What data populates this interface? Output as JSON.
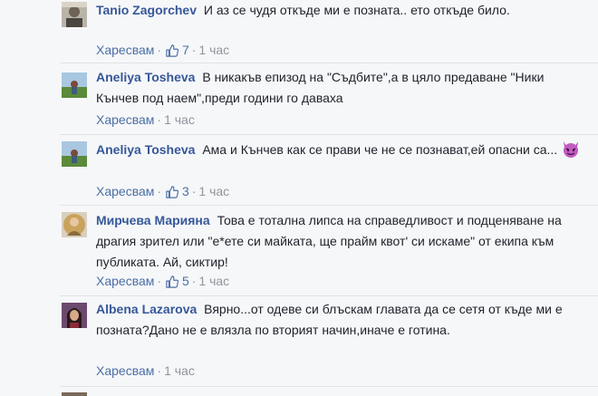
{
  "comments": [
    {
      "author": "Tanio Zagorchev",
      "text": "И аз се чудя откъде ми е позната.. ето откъде било.",
      "like_label": "Харесвам",
      "likes": "7",
      "time": "1 час"
    },
    {
      "author": "Aneliya Tosheva",
      "text": "В никакъв епизод на \"Съдбите\",а в цяло предаване \"Ники Кънчев под наем\",преди години го даваха",
      "like_label": "Харесвам",
      "likes": "",
      "time": "1 час"
    },
    {
      "author": "Aneliya Tosheva",
      "text": "Ама и Кънчев как се прави че не се познават,ей опасни са...",
      "like_label": "Харесвам",
      "likes": "3",
      "time": "1 час",
      "emoji": "devil-emoji"
    },
    {
      "author": "Мирчева Марияна",
      "text": "Това е тотална липса на справедливост и подценяване на драгия зрител или \"е*ете си майката, ще прайм квот' си искаме\" от екипа към публиката. Ай, сиктир!",
      "like_label": "Харесвам",
      "likes": "5",
      "time": "1 час"
    },
    {
      "author": "Albena Lazarova",
      "text": "Вярно...от одеве си блъскам главата да се сетя от къде ми е позната?Дано не е влязла по вторият начин,иначе е готина.",
      "like_label": "Харесвам",
      "likes": "",
      "time": "1 час"
    }
  ],
  "colors": {
    "author": "#365899",
    "meta": "#90949c",
    "background": "#f6f7f9"
  }
}
